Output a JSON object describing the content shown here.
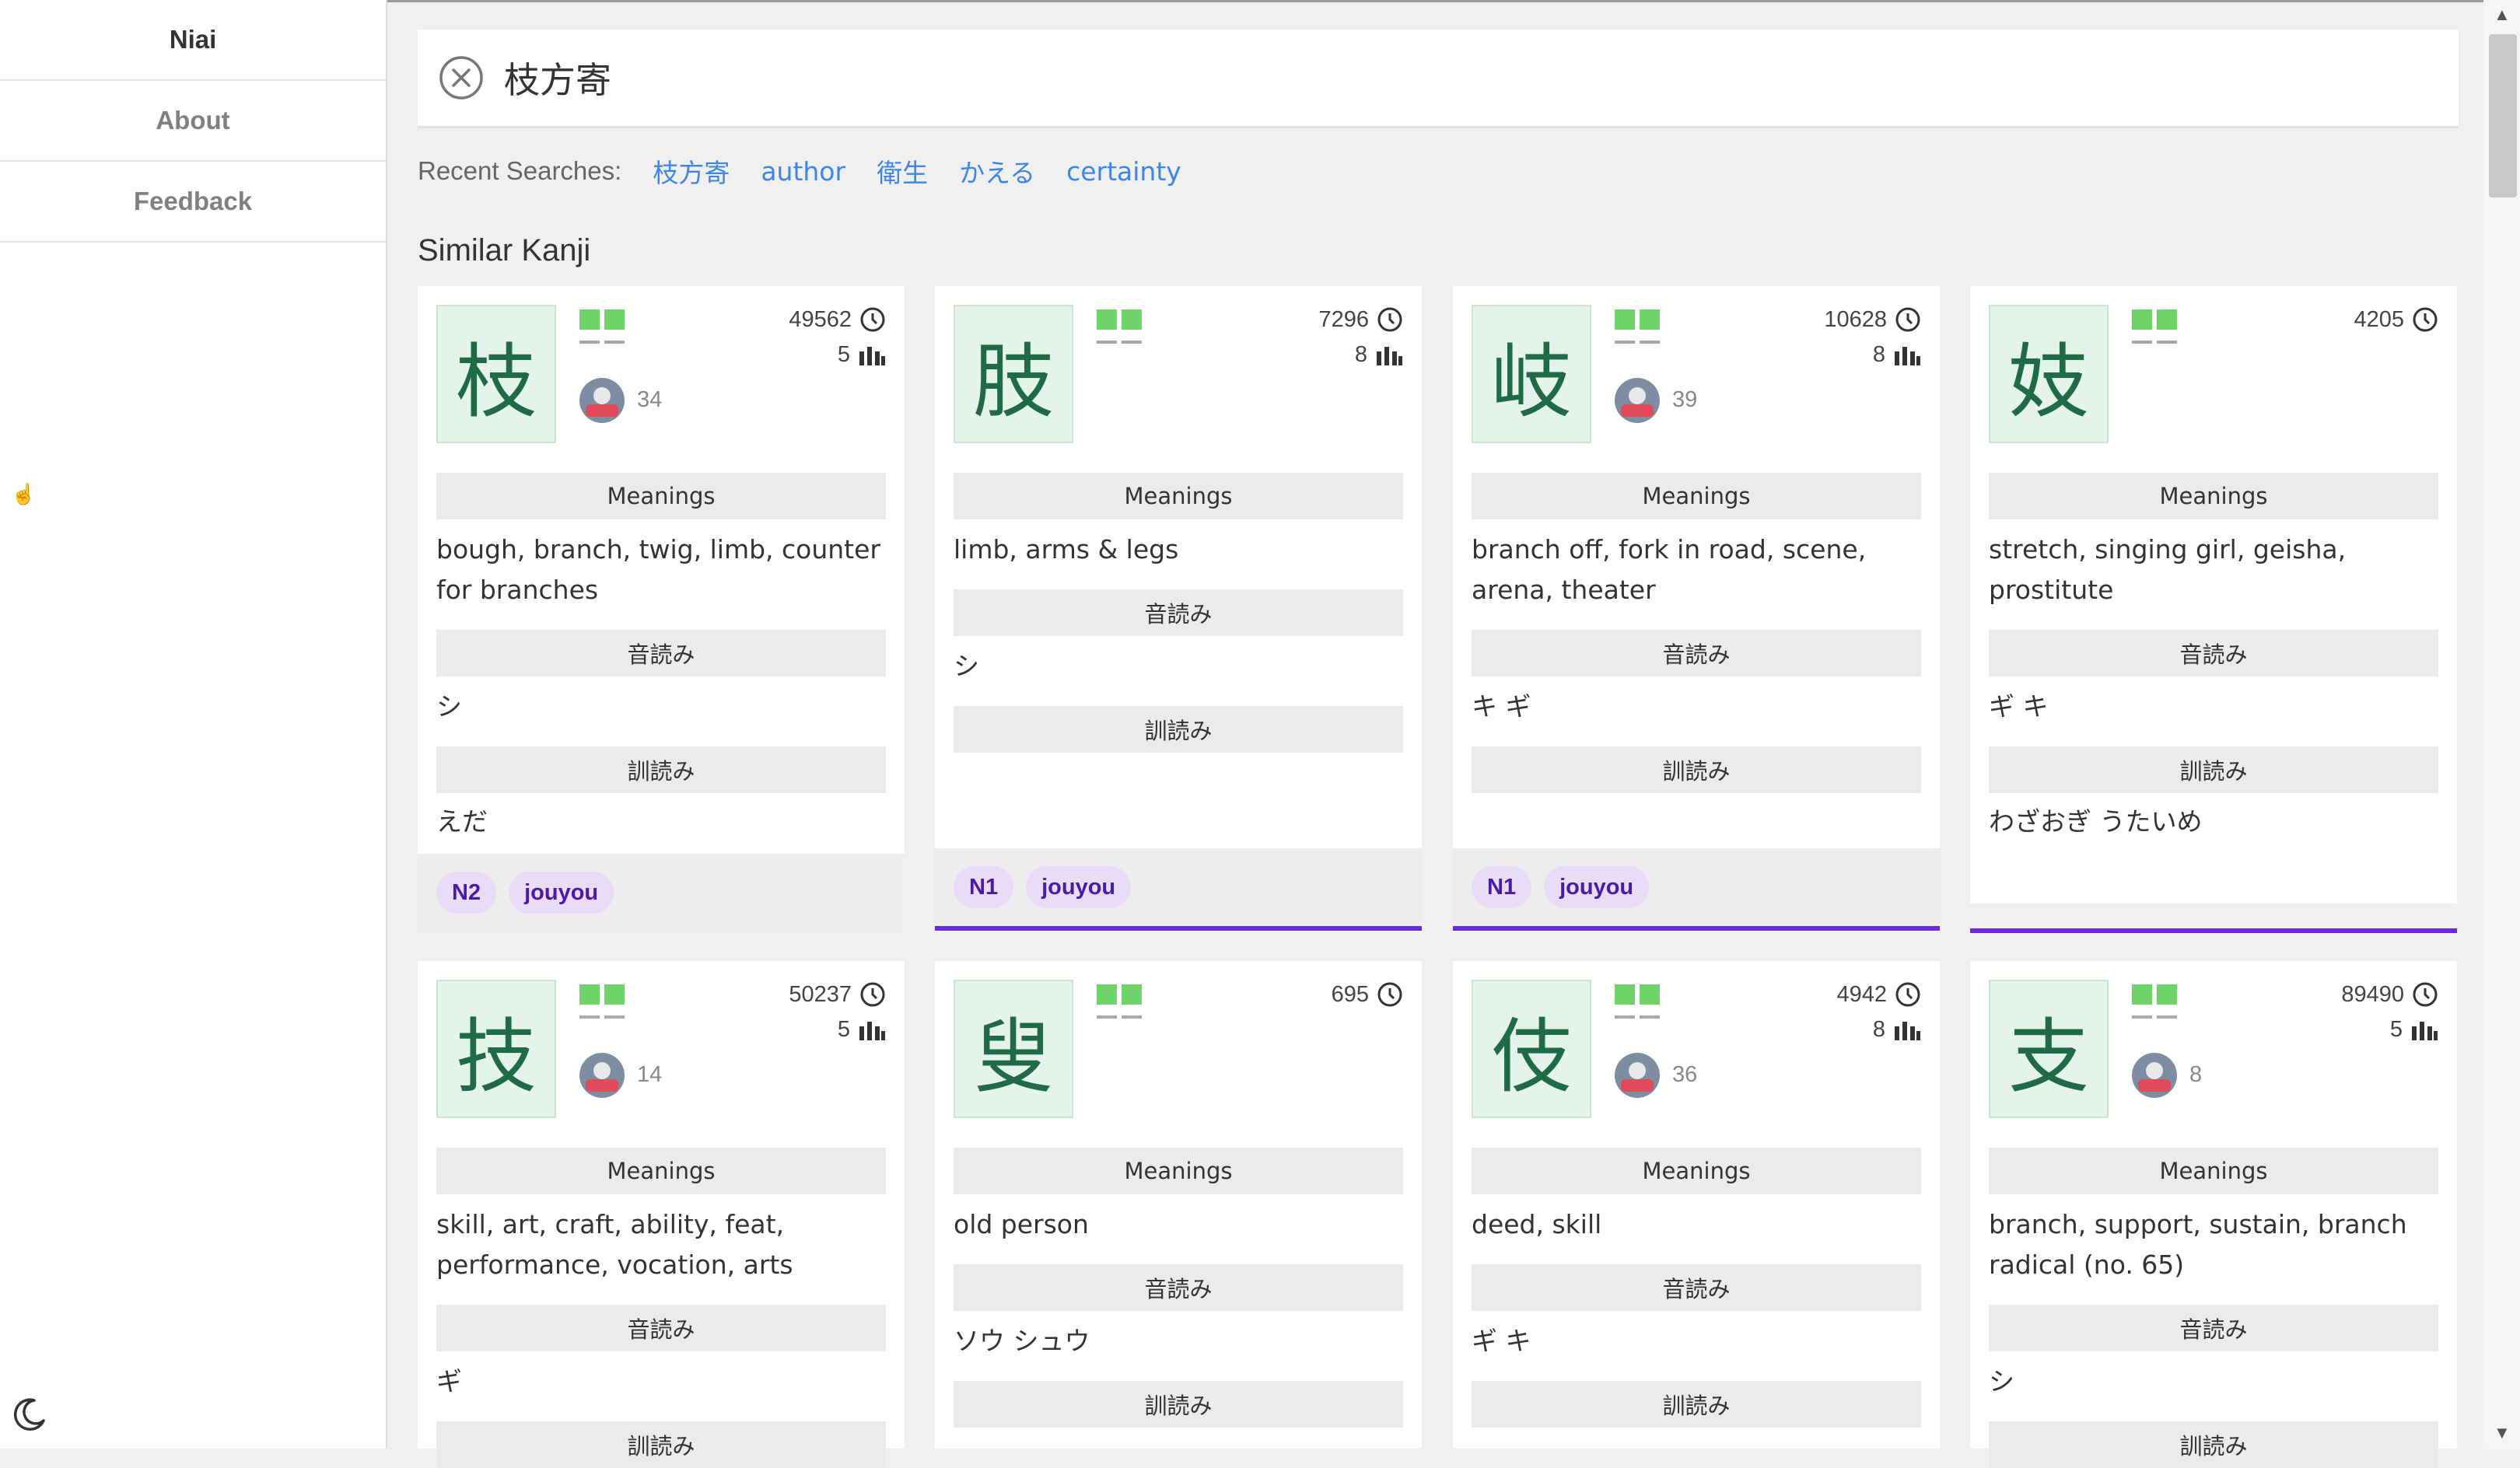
{
  "sidebar": {
    "brand": "Niai",
    "items": [
      {
        "label": "About"
      },
      {
        "label": "Feedback"
      }
    ]
  },
  "search": {
    "value": "枝方寄"
  },
  "recent": {
    "label": "Recent Searches:",
    "items": [
      "枝方寄",
      "author",
      "衛生",
      "かえる",
      "certainty"
    ]
  },
  "section_title": "Similar Kanji",
  "colors": {
    "accent": "#6a2be0",
    "link": "#3d86e6",
    "kanji_bg": "#e5f4ea"
  },
  "headers": {
    "meanings": "Meanings",
    "onyomi": "音読み",
    "kunyomi": "訓読み"
  },
  "cards": [
    {
      "kanji": "枝",
      "freq": "49562",
      "strokes": "5",
      "avatar_count": "34",
      "meanings": "bough, branch, twig, limb, counter for branches",
      "onyomi": "シ",
      "kunyomi": "えだ",
      "tags": [
        "N2",
        "jouyou"
      ]
    },
    {
      "kanji": "肢",
      "freq": "7296",
      "strokes": "8",
      "avatar_count": "",
      "meanings": "limb, arms & legs",
      "onyomi": "シ",
      "kunyomi": "",
      "tags": [
        "N1",
        "jouyou"
      ]
    },
    {
      "kanji": "岐",
      "freq": "10628",
      "strokes": "8",
      "avatar_count": "39",
      "meanings": "branch off, fork in road, scene, arena, theater",
      "onyomi": "キ ギ",
      "kunyomi": "",
      "tags": [
        "N1",
        "jouyou"
      ]
    },
    {
      "kanji": "妓",
      "freq": "4205",
      "strokes": "",
      "avatar_count": "",
      "meanings": "stretch, singing girl, geisha, prostitute",
      "onyomi": "ギ キ",
      "kunyomi": "わざおぎ うたいめ",
      "tags": []
    },
    {
      "kanji": "技",
      "freq": "50237",
      "strokes": "5",
      "avatar_count": "14",
      "meanings": "skill, art, craft, ability, feat, performance, vocation, arts",
      "onyomi": "ギ",
      "kunyomi": "",
      "tags": []
    },
    {
      "kanji": "叟",
      "freq": "695",
      "strokes": "",
      "avatar_count": "",
      "meanings": "old person",
      "onyomi": "ソウ シュウ",
      "kunyomi": "",
      "tags": []
    },
    {
      "kanji": "伎",
      "freq": "4942",
      "strokes": "8",
      "avatar_count": "36",
      "meanings": "deed, skill",
      "onyomi": "ギ キ",
      "kunyomi": "",
      "tags": []
    },
    {
      "kanji": "支",
      "freq": "89490",
      "strokes": "5",
      "avatar_count": "8",
      "meanings": "branch, support, sustain, branch radical (no. 65)",
      "onyomi": "シ",
      "kunyomi": "",
      "tags": []
    }
  ]
}
